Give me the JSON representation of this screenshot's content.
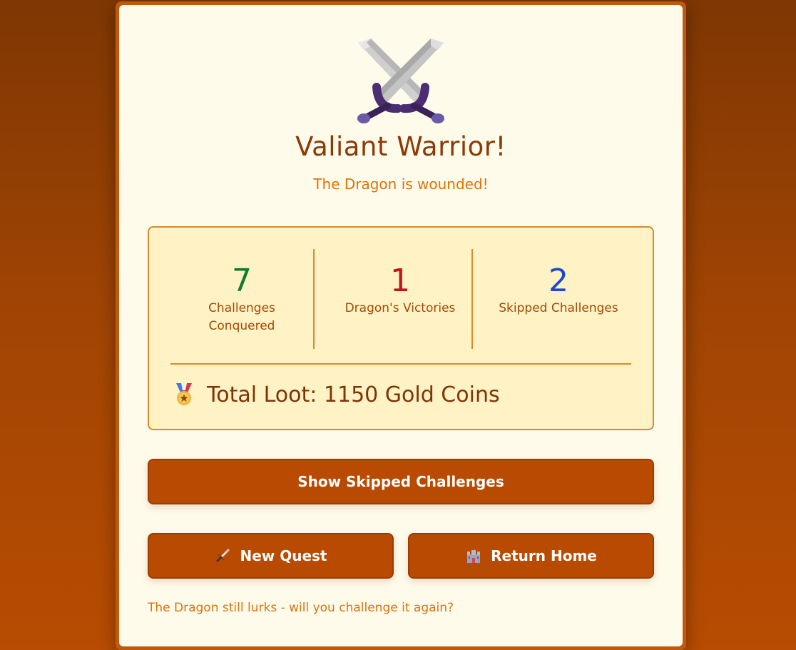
{
  "results": {
    "hero_icon": "crossed-swords-icon",
    "title": "Valiant Warrior!",
    "subtitle": "The Dragon is wounded!"
  },
  "stats": [
    {
      "value": "7",
      "label": "Challenges Conquered",
      "color": "#0e7a2c"
    },
    {
      "value": "1",
      "label": "Dragon's Victories",
      "color": "#c0161b"
    },
    {
      "value": "2",
      "label": "Skipped Challenges",
      "color": "#1c49d1"
    }
  ],
  "loot": {
    "icon": "medal-icon",
    "text": "Total Loot: 1150 Gold Coins"
  },
  "actions": {
    "show_skipped_label": "Show Skipped Challenges",
    "new_quest_label": "New Quest",
    "new_quest_icon": "dagger-icon",
    "return_home_label": "Return Home",
    "return_home_icon": "castle-icon"
  },
  "footer": {
    "message": "The Dragon still lurks - will you challenge it again?"
  },
  "colors": {
    "accent": "#b94a02",
    "card_background": "#fffbea",
    "panel_background": "#fff2c4",
    "title": "#8a3a06"
  }
}
